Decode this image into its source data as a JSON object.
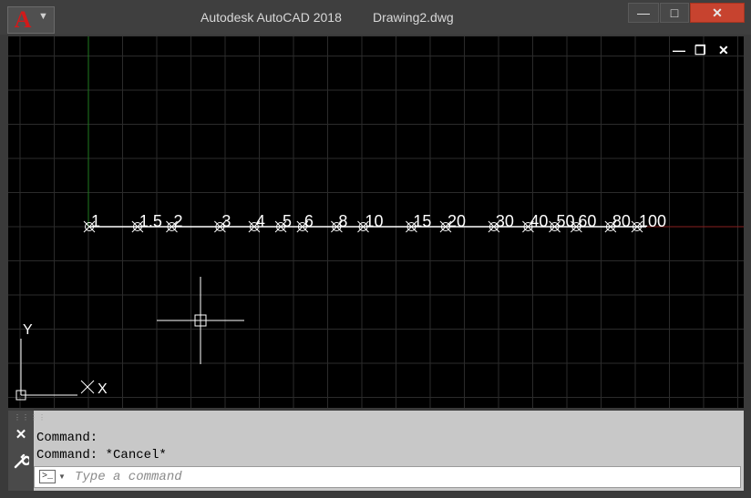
{
  "titlebar": {
    "app_title": "Autodesk AutoCAD 2018",
    "file_name": "Drawing2.dwg",
    "app_menu_icon": "autocad-logo-icon",
    "minimize_label": "—",
    "maximize_label": "□",
    "close_label": "✕"
  },
  "drawing": {
    "background_color": "#000000",
    "grid_color": "#2b2b2b",
    "axis_color_y": "#1f7a1f",
    "axis_color_x": "#8a1f1f",
    "line_color": "#ffffff",
    "scale_labels": [
      "1",
      "1.5",
      "2",
      "3",
      "4",
      "5",
      "6",
      "8",
      "10",
      "15",
      "20",
      "30",
      "40",
      "50",
      "60",
      "80",
      "100"
    ],
    "ucs_y_label": "Y",
    "ucs_x_label": "X",
    "controls": {
      "minimize": "—",
      "restore": "❐",
      "close": "✕"
    }
  },
  "command": {
    "history": [
      "Command:",
      "Command: *Cancel*"
    ],
    "input_placeholder": "Type a command",
    "close_icon": "close-icon",
    "settings_icon": "wrench-icon",
    "prompt_icon": "command-prompt-icon"
  }
}
